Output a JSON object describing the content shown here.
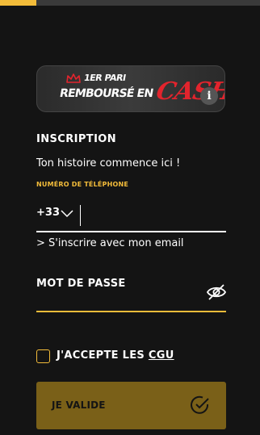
{
  "progress": {
    "fraction": 0.14,
    "color": "#f3bc3a"
  },
  "banner": {
    "line1": "1ER PARI",
    "line2": "REMBOURSÉ EN",
    "cash": "CASH",
    "info_icon": "info-icon",
    "info_glyph": "i"
  },
  "form": {
    "heading": "INSCRIPTION",
    "tagline": "Ton histoire commence ici !",
    "phone_label": "NUMÉRO DE TÉLÉPHONE",
    "country_code": "+33",
    "phone_value": "",
    "email_link": "> S'inscrire avec mon email",
    "password_label": "MOT DE PASSE",
    "password_value": "",
    "accept_prefix": "J'ACCEPTE LES ",
    "accept_link": "CGU",
    "accept_checked": false,
    "submit_label": "JE VALIDE"
  },
  "colors": {
    "background": "#141414",
    "accent": "#f3bc3a",
    "cash_red": "#e2242d",
    "button": "#7a6018"
  }
}
